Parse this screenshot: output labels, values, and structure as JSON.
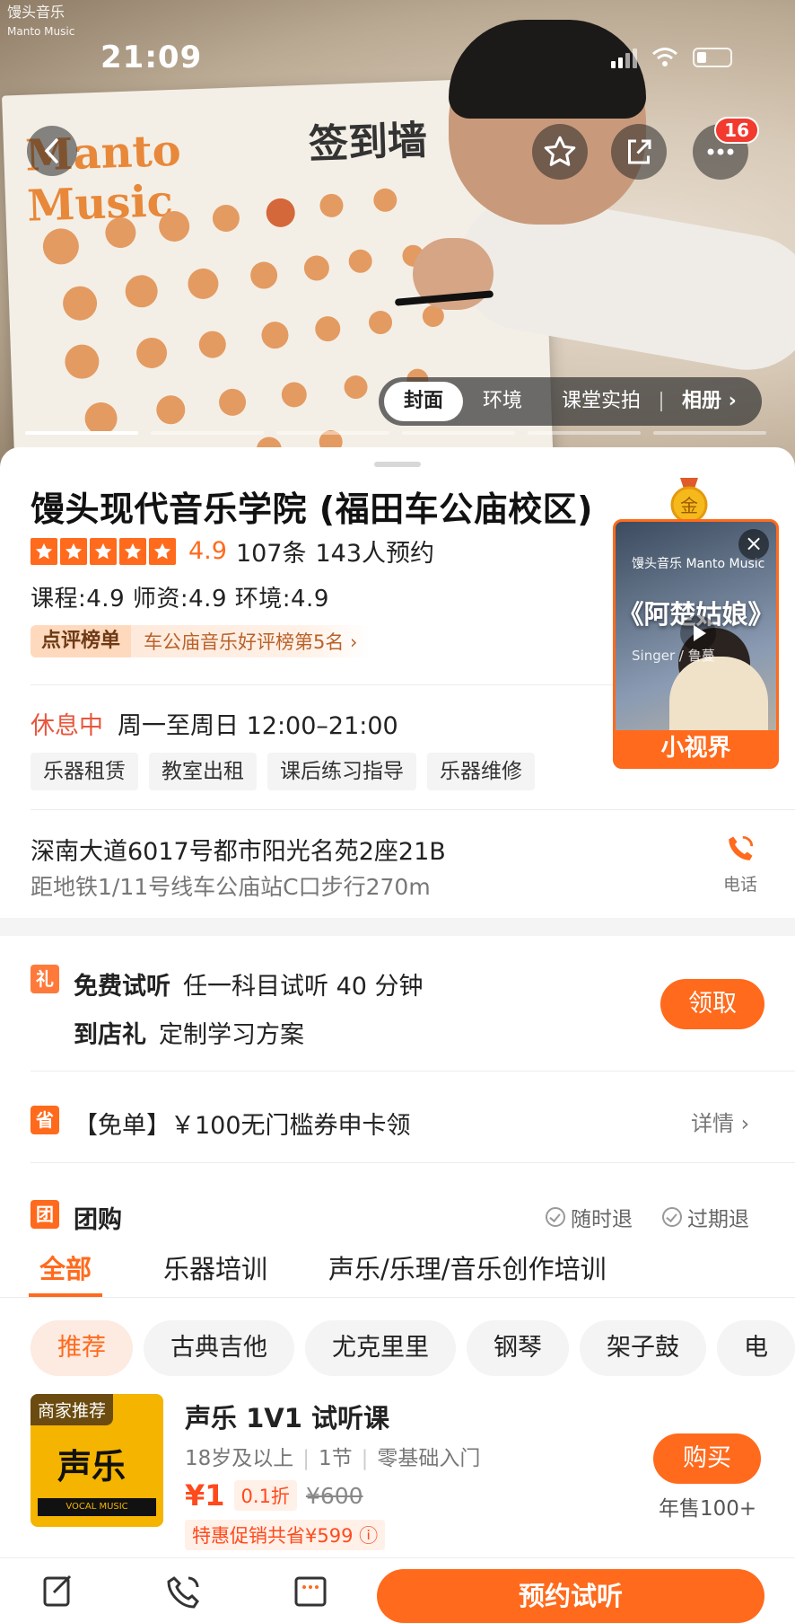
{
  "status": {
    "time": "21:09"
  },
  "hero": {
    "logo_text": "馒头音乐",
    "logo_sub": "Manto Music",
    "board_text_1": "Manto",
    "board_text_2": "Music",
    "board_text_3": "签到墙",
    "more_badge": "16",
    "media_tabs": [
      "封面",
      "环境",
      "课堂实拍",
      "相册 ›"
    ]
  },
  "shop": {
    "title": "馒头现代音乐学院 (福田车公庙校区)",
    "gold_badge": "金",
    "rating": "4.9",
    "reviews": "107条",
    "bookings": "143人预约",
    "sub_scores": "课程:4.9  师资:4.9  环境:4.9",
    "rank_tag": "点评榜单",
    "rank_text": "车公庙音乐好评榜第5名 ›",
    "status": "休息中",
    "hours": "周一至周日 12:00–21:00",
    "services": [
      "乐器租赁",
      "教室出租",
      "课后练习指导",
      "乐器维修"
    ],
    "address": "深南大道6017号都市阳光名苑2座21B",
    "distance": "距地铁1/11号线车公庙站C口步行270m",
    "phone_label": "电话"
  },
  "mini_video": {
    "logo": "馒头音乐 Manto Music",
    "title": "《阿楚姑娘》",
    "singer": "Singer / 鲁蔓",
    "band": "小视界",
    "close": "×"
  },
  "gifts": {
    "icon": "礼",
    "free_title": "免费试听",
    "free_desc": "任一科目试听 40 分钟",
    "store_title": "到店礼",
    "store_desc": "定制学习方案",
    "claim": "领取"
  },
  "coupon": {
    "icon": "省",
    "text": "【免单】￥100无门槛券申卡领",
    "detail": "详情 ›"
  },
  "group": {
    "icon": "团",
    "title": "团购",
    "refund_any": "随时退",
    "refund_expired": "过期退",
    "categories": [
      "全部",
      "乐器培训",
      "声乐/乐理/音乐创作培训"
    ],
    "pills": [
      "推荐",
      "古典吉他",
      "尤克里里",
      "钢琴",
      "架子鼓",
      "电"
    ]
  },
  "deal": {
    "img_tag": "商家推荐",
    "img_big": "声乐",
    "img_banner": "VOCAL MUSIC",
    "title": "声乐 1V1 试听课",
    "meta": [
      "18岁及以上",
      "|",
      "1节",
      "|",
      "零基础入门"
    ],
    "price": "¥1",
    "discount": "0.1折",
    "original": "¥600",
    "promo": "特惠促销共省¥599 ⓘ",
    "buy": "购买",
    "sales": "年售100+"
  },
  "bottom": {
    "reserve": "预约试听"
  },
  "colors": {
    "accent": "#ff6a1c",
    "rest_status": "#e8563c"
  }
}
